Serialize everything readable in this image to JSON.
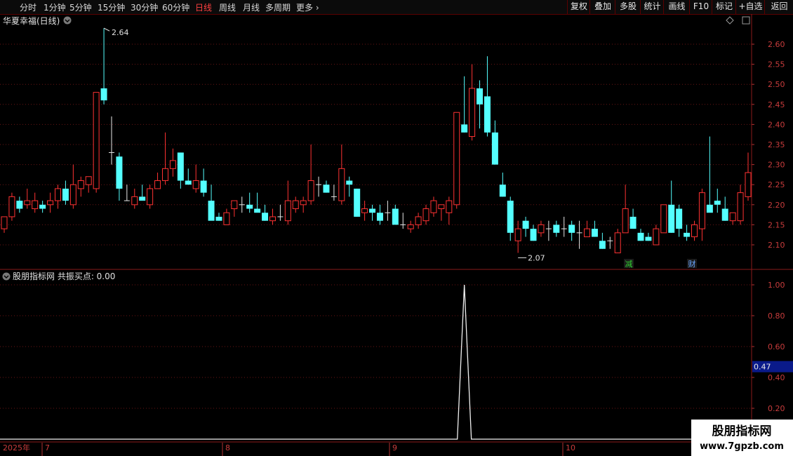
{
  "toolbar": {
    "periods": [
      "分时",
      "1分钟",
      "5分钟",
      "15分钟",
      "30分钟",
      "60分钟",
      "日线",
      "周线",
      "月线",
      "多周期",
      "更多"
    ],
    "active_period": "日线",
    "buttons": [
      "复权",
      "叠加",
      "多股",
      "统计",
      "画线",
      "F10",
      "标记",
      "+自选",
      "返回"
    ]
  },
  "main_panel": {
    "title": "华夏幸福(日线)",
    "y_ticks": [
      "2.60",
      "2.55",
      "2.50",
      "2.45",
      "2.40",
      "2.35",
      "2.30",
      "2.25",
      "2.20",
      "2.15",
      "2.10"
    ],
    "high_label": "2.64",
    "low_label": "2.07",
    "markers": [
      "减",
      "财"
    ]
  },
  "indicator_panel": {
    "title": "股朋指标网 共振买点: 0.00",
    "y_ticks": [
      "1.00",
      "0.80",
      "0.60",
      "0.40",
      "0.20"
    ],
    "current_value": "0.47"
  },
  "date_axis": {
    "year": "2025年",
    "months": [
      "7",
      "8",
      "9",
      "10"
    ]
  },
  "watermark": {
    "name": "股朋指标网",
    "url": "www.7gpzb.com"
  },
  "chart_data": {
    "type": "candlestick",
    "price_range": [
      2.05,
      2.65
    ],
    "indicator_range": [
      0,
      1.05
    ],
    "candles": [
      [
        2.14,
        2.17,
        2.13,
        2.17
      ],
      [
        2.17,
        2.23,
        2.16,
        2.22
      ],
      [
        2.21,
        2.22,
        2.18,
        2.19
      ],
      [
        2.2,
        2.24,
        2.19,
        2.21
      ],
      [
        2.19,
        2.23,
        2.18,
        2.21
      ],
      [
        2.2,
        2.21,
        2.18,
        2.19
      ],
      [
        2.2,
        2.23,
        2.18,
        2.21
      ],
      [
        2.21,
        2.25,
        2.19,
        2.24
      ],
      [
        2.24,
        2.26,
        2.2,
        2.21
      ],
      [
        2.2,
        2.3,
        2.19,
        2.25
      ],
      [
        2.24,
        2.27,
        2.22,
        2.26
      ],
      [
        2.25,
        2.27,
        2.23,
        2.27
      ],
      [
        2.24,
        2.48,
        2.23,
        2.48
      ],
      [
        2.49,
        2.64,
        2.45,
        2.46
      ],
      [
        2.33,
        2.42,
        2.3,
        2.33
      ],
      [
        2.32,
        2.33,
        2.21,
        2.24
      ],
      [
        2.21,
        2.25,
        2.21,
        2.21
      ],
      [
        2.2,
        2.24,
        2.19,
        2.22
      ],
      [
        2.22,
        2.25,
        2.22,
        2.21
      ],
      [
        2.2,
        2.25,
        2.19,
        2.24
      ],
      [
        2.24,
        2.28,
        2.24,
        2.26
      ],
      [
        2.26,
        2.38,
        2.25,
        2.29
      ],
      [
        2.29,
        2.34,
        2.27,
        2.31
      ],
      [
        2.33,
        2.33,
        2.24,
        2.26
      ],
      [
        2.26,
        2.29,
        2.25,
        2.25
      ],
      [
        2.24,
        2.3,
        2.23,
        2.26
      ],
      [
        2.26,
        2.29,
        2.22,
        2.23
      ],
      [
        2.21,
        2.25,
        2.19,
        2.16
      ],
      [
        2.17,
        2.18,
        2.16,
        2.16
      ],
      [
        2.15,
        2.19,
        2.15,
        2.18
      ],
      [
        2.19,
        2.21,
        2.17,
        2.21
      ],
      [
        2.2,
        2.22,
        2.18,
        2.2
      ],
      [
        2.2,
        2.23,
        2.18,
        2.19
      ],
      [
        2.19,
        2.23,
        2.19,
        2.18
      ],
      [
        2.18,
        2.2,
        2.16,
        2.16
      ],
      [
        2.16,
        2.19,
        2.15,
        2.17
      ],
      [
        2.17,
        2.2,
        2.16,
        2.17
      ],
      [
        2.16,
        2.26,
        2.15,
        2.21
      ],
      [
        2.19,
        2.22,
        2.18,
        2.21
      ],
      [
        2.2,
        2.22,
        2.18,
        2.21
      ],
      [
        2.21,
        2.35,
        2.2,
        2.26
      ],
      [
        2.25,
        2.27,
        2.22,
        2.25
      ],
      [
        2.25,
        2.26,
        2.23,
        2.23
      ],
      [
        2.22,
        2.25,
        2.21,
        2.22
      ],
      [
        2.21,
        2.35,
        2.2,
        2.29
      ],
      [
        2.26,
        2.27,
        2.22,
        2.25
      ],
      [
        2.24,
        2.24,
        2.17,
        2.17
      ],
      [
        2.18,
        2.21,
        2.16,
        2.19
      ],
      [
        2.19,
        2.2,
        2.16,
        2.18
      ],
      [
        2.18,
        2.2,
        2.15,
        2.16
      ],
      [
        2.18,
        2.21,
        2.16,
        2.18
      ],
      [
        2.19,
        2.2,
        2.16,
        2.15
      ],
      [
        2.15,
        2.18,
        2.14,
        2.15
      ],
      [
        2.14,
        2.16,
        2.13,
        2.15
      ],
      [
        2.15,
        2.18,
        2.14,
        2.17
      ],
      [
        2.16,
        2.2,
        2.15,
        2.19
      ],
      [
        2.18,
        2.22,
        2.17,
        2.21
      ],
      [
        2.19,
        2.2,
        2.16,
        2.2
      ],
      [
        2.18,
        2.22,
        2.15,
        2.21
      ],
      [
        2.2,
        2.43,
        2.19,
        2.43
      ],
      [
        2.4,
        2.52,
        2.38,
        2.38
      ],
      [
        2.37,
        2.55,
        2.36,
        2.49
      ],
      [
        2.49,
        2.51,
        2.39,
        2.45
      ],
      [
        2.47,
        2.57,
        2.37,
        2.38
      ],
      [
        2.38,
        2.41,
        2.3,
        2.3
      ],
      [
        2.25,
        2.28,
        2.22,
        2.22
      ],
      [
        2.21,
        2.22,
        2.11,
        2.13
      ],
      [
        2.11,
        2.16,
        2.08,
        2.14
      ],
      [
        2.16,
        2.17,
        2.12,
        2.14
      ],
      [
        2.14,
        2.15,
        2.11,
        2.11
      ],
      [
        2.13,
        2.16,
        2.12,
        2.15
      ],
      [
        2.14,
        2.16,
        2.11,
        2.14
      ],
      [
        2.15,
        2.16,
        2.12,
        2.13
      ],
      [
        2.14,
        2.17,
        2.12,
        2.14
      ],
      [
        2.15,
        2.16,
        2.11,
        2.13
      ],
      [
        2.13,
        2.16,
        2.09,
        2.13
      ],
      [
        2.12,
        2.16,
        2.12,
        2.14
      ],
      [
        2.14,
        2.16,
        2.12,
        2.12
      ],
      [
        2.11,
        2.13,
        2.09,
        2.09
      ],
      [
        2.11,
        2.12,
        2.09,
        2.11
      ],
      [
        2.08,
        2.14,
        2.08,
        2.13
      ],
      [
        2.13,
        2.25,
        2.13,
        2.19
      ],
      [
        2.17,
        2.19,
        2.14,
        2.14
      ],
      [
        2.13,
        2.14,
        2.11,
        2.11
      ],
      [
        2.12,
        2.13,
        2.11,
        2.11
      ],
      [
        2.1,
        2.15,
        2.1,
        2.14
      ],
      [
        2.13,
        2.19,
        2.13,
        2.2
      ],
      [
        2.2,
        2.26,
        2.13,
        2.13
      ],
      [
        2.19,
        2.2,
        2.12,
        2.14
      ],
      [
        2.13,
        2.15,
        2.11,
        2.12
      ],
      [
        2.12,
        2.16,
        2.11,
        2.15
      ],
      [
        2.14,
        2.24,
        2.11,
        2.23
      ],
      [
        2.2,
        2.37,
        2.19,
        2.18
      ],
      [
        2.21,
        2.24,
        2.18,
        2.2
      ],
      [
        2.19,
        2.22,
        2.16,
        2.16
      ],
      [
        2.16,
        2.18,
        2.15,
        2.18
      ],
      [
        2.16,
        2.25,
        2.15,
        2.23
      ],
      [
        2.22,
        2.33,
        2.21,
        2.28
      ]
    ],
    "signal": {
      "baseline": 0.0,
      "peak_value": 1.0,
      "peak_index": 60
    }
  }
}
